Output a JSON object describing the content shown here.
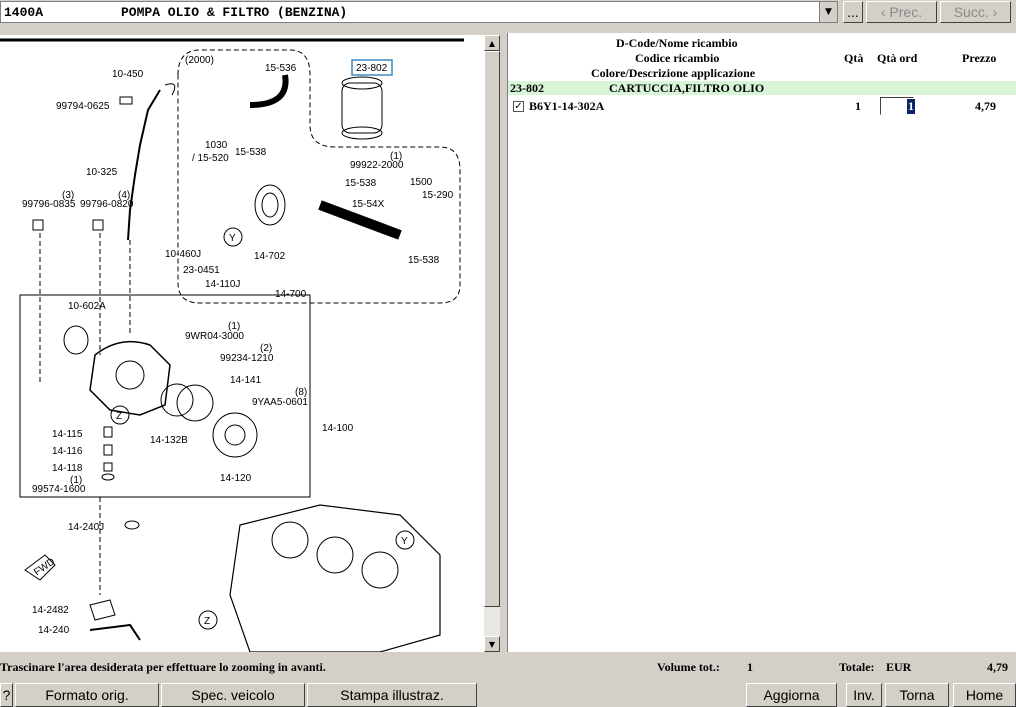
{
  "header": {
    "code": "1400A",
    "title": "POMPA OLIO & FILTRO (BENZINA)",
    "ellipsis_label": "...",
    "prev_label": "‹ Prec.",
    "next_label": "Succ. ›"
  },
  "diagram": {
    "labels": [
      "(2000)",
      "10-450",
      "99794-0625",
      "10-325",
      "99796-0835",
      "(3)",
      "99796-0820",
      "(4)",
      "10-460J",
      "23-0451",
      "14-110J",
      "10-602A",
      "9WR04-3000",
      "(1)",
      "99234-1210",
      "(2)",
      "14-141",
      "9YAA5-0601",
      "(8)",
      "14-100",
      "14-132B",
      "14-115",
      "14-116",
      "14-118",
      "99574-1600",
      "(1)",
      "14-120",
      "14-240J",
      "14-2482",
      "14-240",
      "15-536",
      "23-802",
      "1030",
      "/ 15-520",
      "15-538",
      "99922-2000",
      "(1)",
      "15-538",
      "1500",
      "15-290",
      "15-54X",
      "14-702",
      "15-538",
      "14-700",
      "Y",
      "Z",
      "Y",
      "Z",
      "FWD"
    ]
  },
  "parts_table": {
    "header_line1": "D-Code/Nome ricambio",
    "header_line2": "Codice ricambio",
    "header_line3": "Colore/Descrizione applicazione",
    "col_qty": "Qtà",
    "col_qty_ord": "Qtà ord",
    "col_price": "Prezzo",
    "group": {
      "code": "23-802",
      "name": "CARTUCCIA,FILTRO OLIO"
    },
    "rows": [
      {
        "checked": true,
        "part_no": "B6Y1-14-302A",
        "qty": "1",
        "qty_ord": "1",
        "price": "4,79"
      }
    ]
  },
  "status": {
    "hint": "Trascinare l'area desiderata per effettuare lo zooming in avanti.",
    "volume_label": "Volume tot.:",
    "volume_value": "1",
    "total_label": "Totale:",
    "currency": "EUR",
    "total_value": "4,79"
  },
  "buttons": {
    "help": "?",
    "formato": "Formato orig.",
    "spec": "Spec. veicolo",
    "stampa": "Stampa illustraz.",
    "aggiorna": "Aggiorna",
    "inv": "Inv.",
    "torna": "Torna",
    "home": "Home"
  },
  "colors": {
    "group_row": "#d8f5d8",
    "window_bg": "#d4d0c8",
    "selection": "#0a246a"
  }
}
